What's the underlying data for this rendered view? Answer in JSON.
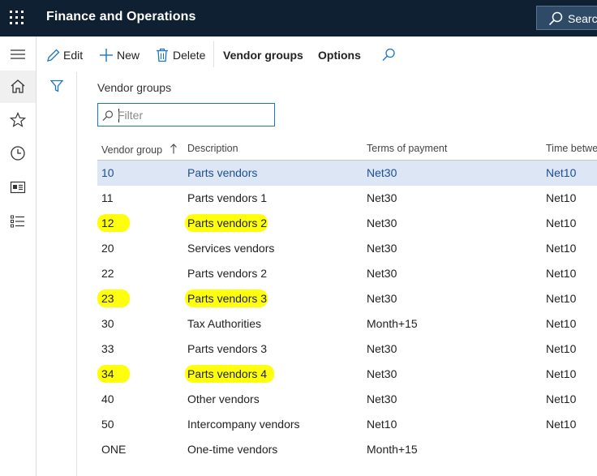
{
  "app": {
    "title": "Finance and Operations",
    "search_label": "Search"
  },
  "actions": {
    "edit": "Edit",
    "new": "New",
    "delete": "Delete",
    "vendor_groups": "Vendor groups",
    "options": "Options"
  },
  "page": {
    "title": "Vendor groups",
    "filter_placeholder": "Filter"
  },
  "grid": {
    "columns": [
      "Vendor group",
      "Description",
      "Terms of payment",
      "Time betwe"
    ],
    "rows": [
      {
        "group": "10",
        "description": "Parts vendors",
        "terms": "Net30",
        "time": "Net10",
        "selected": true,
        "highlighted": false
      },
      {
        "group": "11",
        "description": "Parts vendors 1",
        "terms": "Net30",
        "time": "Net10",
        "selected": false,
        "highlighted": false
      },
      {
        "group": "12",
        "description": "Parts vendors 2",
        "terms": "Net30",
        "time": "Net10",
        "selected": false,
        "highlighted": true
      },
      {
        "group": "20",
        "description": "Services vendors",
        "terms": "Net30",
        "time": "Net10",
        "selected": false,
        "highlighted": false
      },
      {
        "group": "22",
        "description": "Parts vendors 2",
        "terms": "Net30",
        "time": "Net10",
        "selected": false,
        "highlighted": false
      },
      {
        "group": "23",
        "description": "Parts vendors 3",
        "terms": "Net30",
        "time": "Net10",
        "selected": false,
        "highlighted": true
      },
      {
        "group": "30",
        "description": "Tax Authorities",
        "terms": "Month+15",
        "time": "Net10",
        "selected": false,
        "highlighted": false
      },
      {
        "group": "33",
        "description": "Parts vendors 3",
        "terms": "Net30",
        "time": "Net10",
        "selected": false,
        "highlighted": false
      },
      {
        "group": "34",
        "description": "Parts vendors 4",
        "terms": "Net30",
        "time": "Net10",
        "selected": false,
        "highlighted": true
      },
      {
        "group": "40",
        "description": "Other vendors",
        "terms": "Net30",
        "time": "Net10",
        "selected": false,
        "highlighted": false
      },
      {
        "group": "50",
        "description": "Intercompany vendors",
        "terms": "Net10",
        "time": "Net10",
        "selected": false,
        "highlighted": false
      },
      {
        "group": "ONE",
        "description": "One-time vendors",
        "terms": "Month+15",
        "time": "",
        "selected": false,
        "highlighted": false
      }
    ]
  },
  "colors": {
    "topbar": "#0f2033",
    "accent": "#1a74c8",
    "selected_row": "#dce6f4",
    "highlighter": "#ffff00"
  }
}
